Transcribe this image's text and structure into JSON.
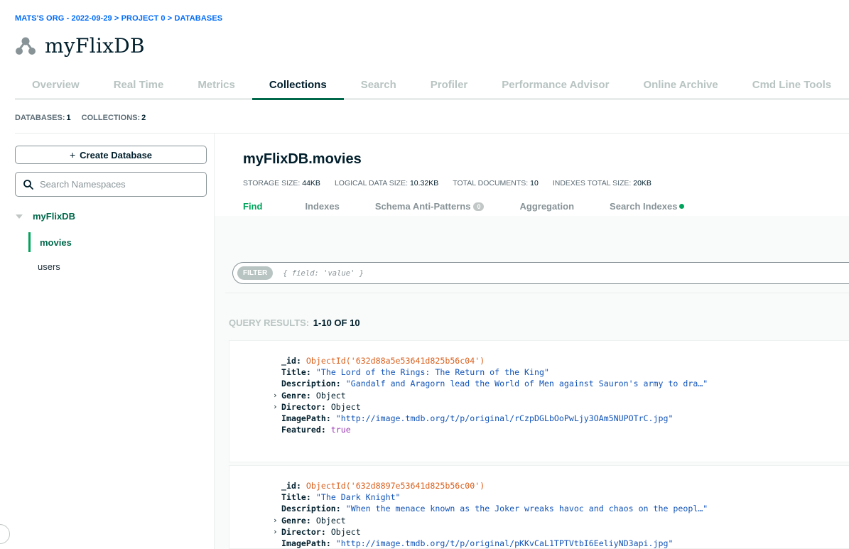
{
  "breadcrumb": {
    "org": "MATS'S ORG - 2022-09-29",
    "sep1": ">",
    "project": "PROJECT 0",
    "sep2": ">",
    "section": "DATABASES"
  },
  "database": {
    "name": "myFlixDB"
  },
  "tabs": [
    {
      "label": "Overview"
    },
    {
      "label": "Real Time"
    },
    {
      "label": "Metrics"
    },
    {
      "label": "Collections",
      "active": true
    },
    {
      "label": "Search"
    },
    {
      "label": "Profiler"
    },
    {
      "label": "Performance Advisor"
    },
    {
      "label": "Online Archive"
    },
    {
      "label": "Cmd Line Tools"
    }
  ],
  "stats": {
    "databases_label": "DATABASES:",
    "databases_value": "1",
    "collections_label": "COLLECTIONS:",
    "collections_value": "2"
  },
  "sidebar": {
    "create_label": "Create Database",
    "create_icon": "plus-icon",
    "search_placeholder": "Search Namespaces",
    "tree": {
      "db": "myFlixDB",
      "collections": [
        "movies",
        "users"
      ]
    }
  },
  "collection": {
    "title": "myFlixDB.movies",
    "stats": [
      {
        "label": "STORAGE SIZE:",
        "value": "44KB"
      },
      {
        "label": "LOGICAL DATA SIZE:",
        "value": "10.32KB"
      },
      {
        "label": "TOTAL DOCUMENTS:",
        "value": "10"
      },
      {
        "label": "INDEXES TOTAL SIZE:",
        "value": "20KB"
      }
    ],
    "subtabs": [
      {
        "label": "Find"
      },
      {
        "label": "Indexes"
      },
      {
        "label": "Schema Anti-Patterns",
        "badge": "0"
      },
      {
        "label": "Aggregation"
      },
      {
        "label": "Search Indexes"
      }
    ]
  },
  "filter": {
    "pill": "FILTER",
    "placeholder": "{ field: 'value' }"
  },
  "results": {
    "label": "QUERY RESULTS:",
    "range": "1-10 OF 10"
  },
  "documents": [
    {
      "id_key": "_id:",
      "id": "ObjectId('632d88a5e53641d825b56c04')",
      "title_key": "Title:",
      "title": "\"The Lord of the Rings: The Return of the King\"",
      "desc_key": "Description:",
      "desc": "\"Gandalf and Aragorn lead the World of Men against Sauron's army to dra…\"",
      "genre_key": "Genre:",
      "genre": "Object",
      "director_key": "Director:",
      "director": "Object",
      "image_key": "ImagePath:",
      "image": "\"http://image.tmdb.org/t/p/original/rCzpDGLbOoPwLjy3OAm5NUPOTrC.jpg\"",
      "featured_key": "Featured:",
      "featured": "true"
    },
    {
      "id_key": "_id:",
      "id": "ObjectId('632d8897e53641d825b56c00')",
      "title_key": "Title:",
      "title": "\"The Dark Knight\"",
      "desc_key": "Description:",
      "desc": "\"When the menace known as the Joker wreaks havoc and chaos on the peopl…\"",
      "genre_key": "Genre:",
      "genre": "Object",
      "director_key": "Director:",
      "director": "Object",
      "image_key": "ImagePath:",
      "image": "\"http://image.tmdb.org/t/p/original/pKKvCaL1TPTVtbI6EeliyND3api.jpg\""
    }
  ],
  "colors": {
    "brand_green": "#00684a",
    "accent_green": "#00a35c",
    "link_blue": "#016bf8",
    "objectid_orange": "#da5f1c",
    "string_blue": "#1254b7",
    "bool_purple": "#9a3bb5"
  }
}
